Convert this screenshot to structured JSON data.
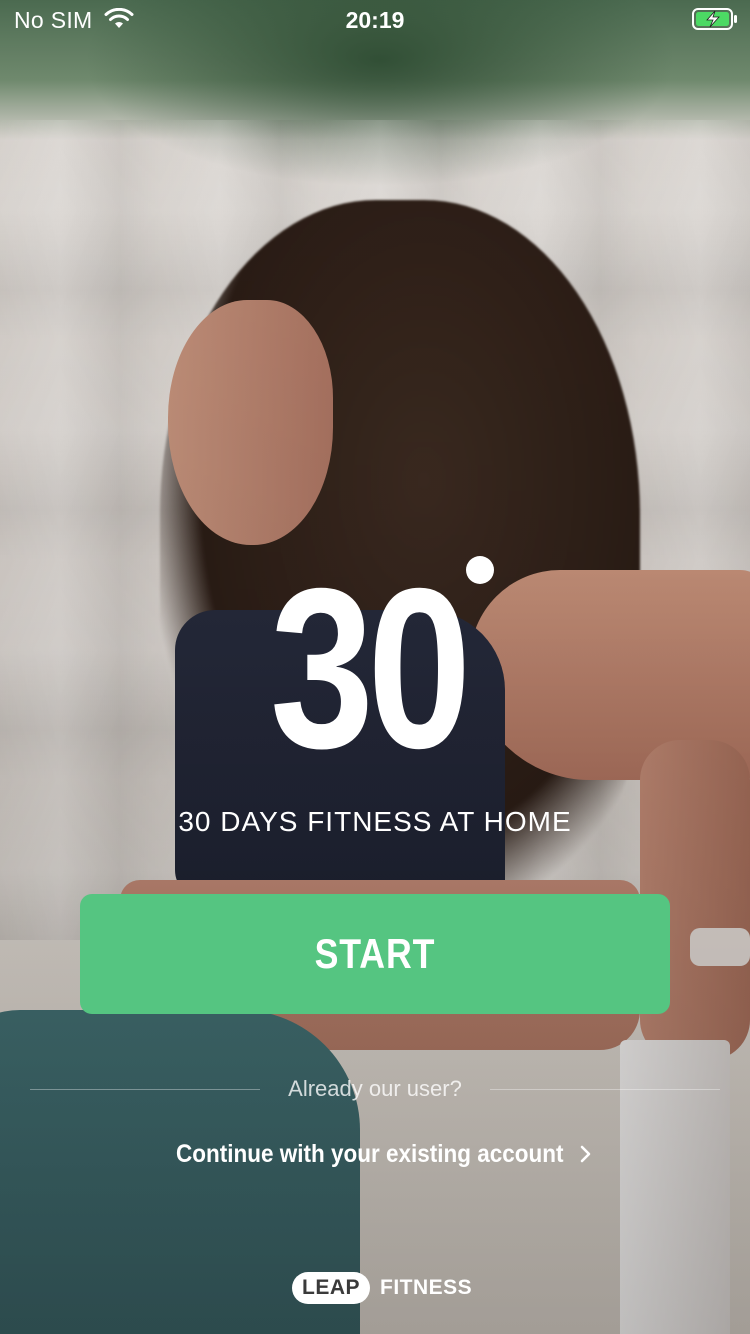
{
  "status_bar": {
    "carrier": "No SIM",
    "time": "20:19",
    "wifi_icon": "wifi-icon",
    "battery_icon": "battery-charging-icon",
    "battery_color": "#4cd964"
  },
  "logo": {
    "number": "30"
  },
  "tagline": "30 DAYS FITNESS AT HOME",
  "start_button": {
    "label": "START",
    "color": "#55c581"
  },
  "account": {
    "prompt": "Already our user?",
    "continue_label": "Continue with your existing account",
    "continue_icon": "chevron-right-icon"
  },
  "brand": {
    "pill_text": "LEAP",
    "word": "FITNESS"
  }
}
